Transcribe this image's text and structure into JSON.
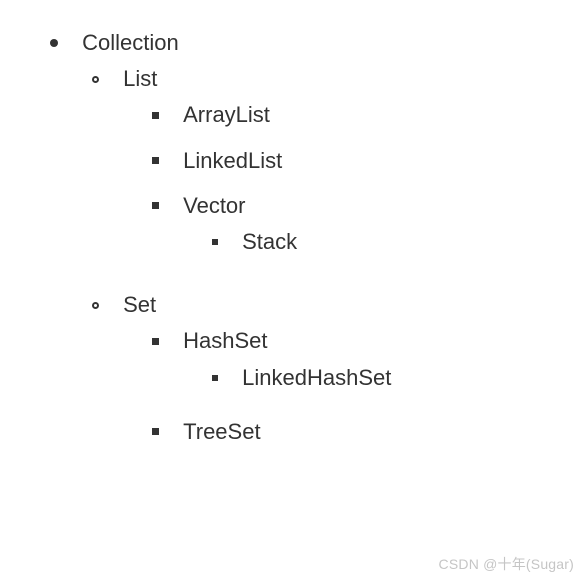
{
  "tree": {
    "label": "Collection",
    "children": [
      {
        "label": "List",
        "children": [
          {
            "label": "ArrayList"
          },
          {
            "label": "LinkedList"
          },
          {
            "label": "Vector",
            "children": [
              {
                "label": "Stack"
              }
            ]
          }
        ]
      },
      {
        "label": "Set",
        "children": [
          {
            "label": "HashSet",
            "children": [
              {
                "label": "LinkedHashSet"
              }
            ]
          },
          {
            "label": "TreeSet"
          }
        ]
      }
    ]
  },
  "watermark": "CSDN @十年(Sugar)"
}
